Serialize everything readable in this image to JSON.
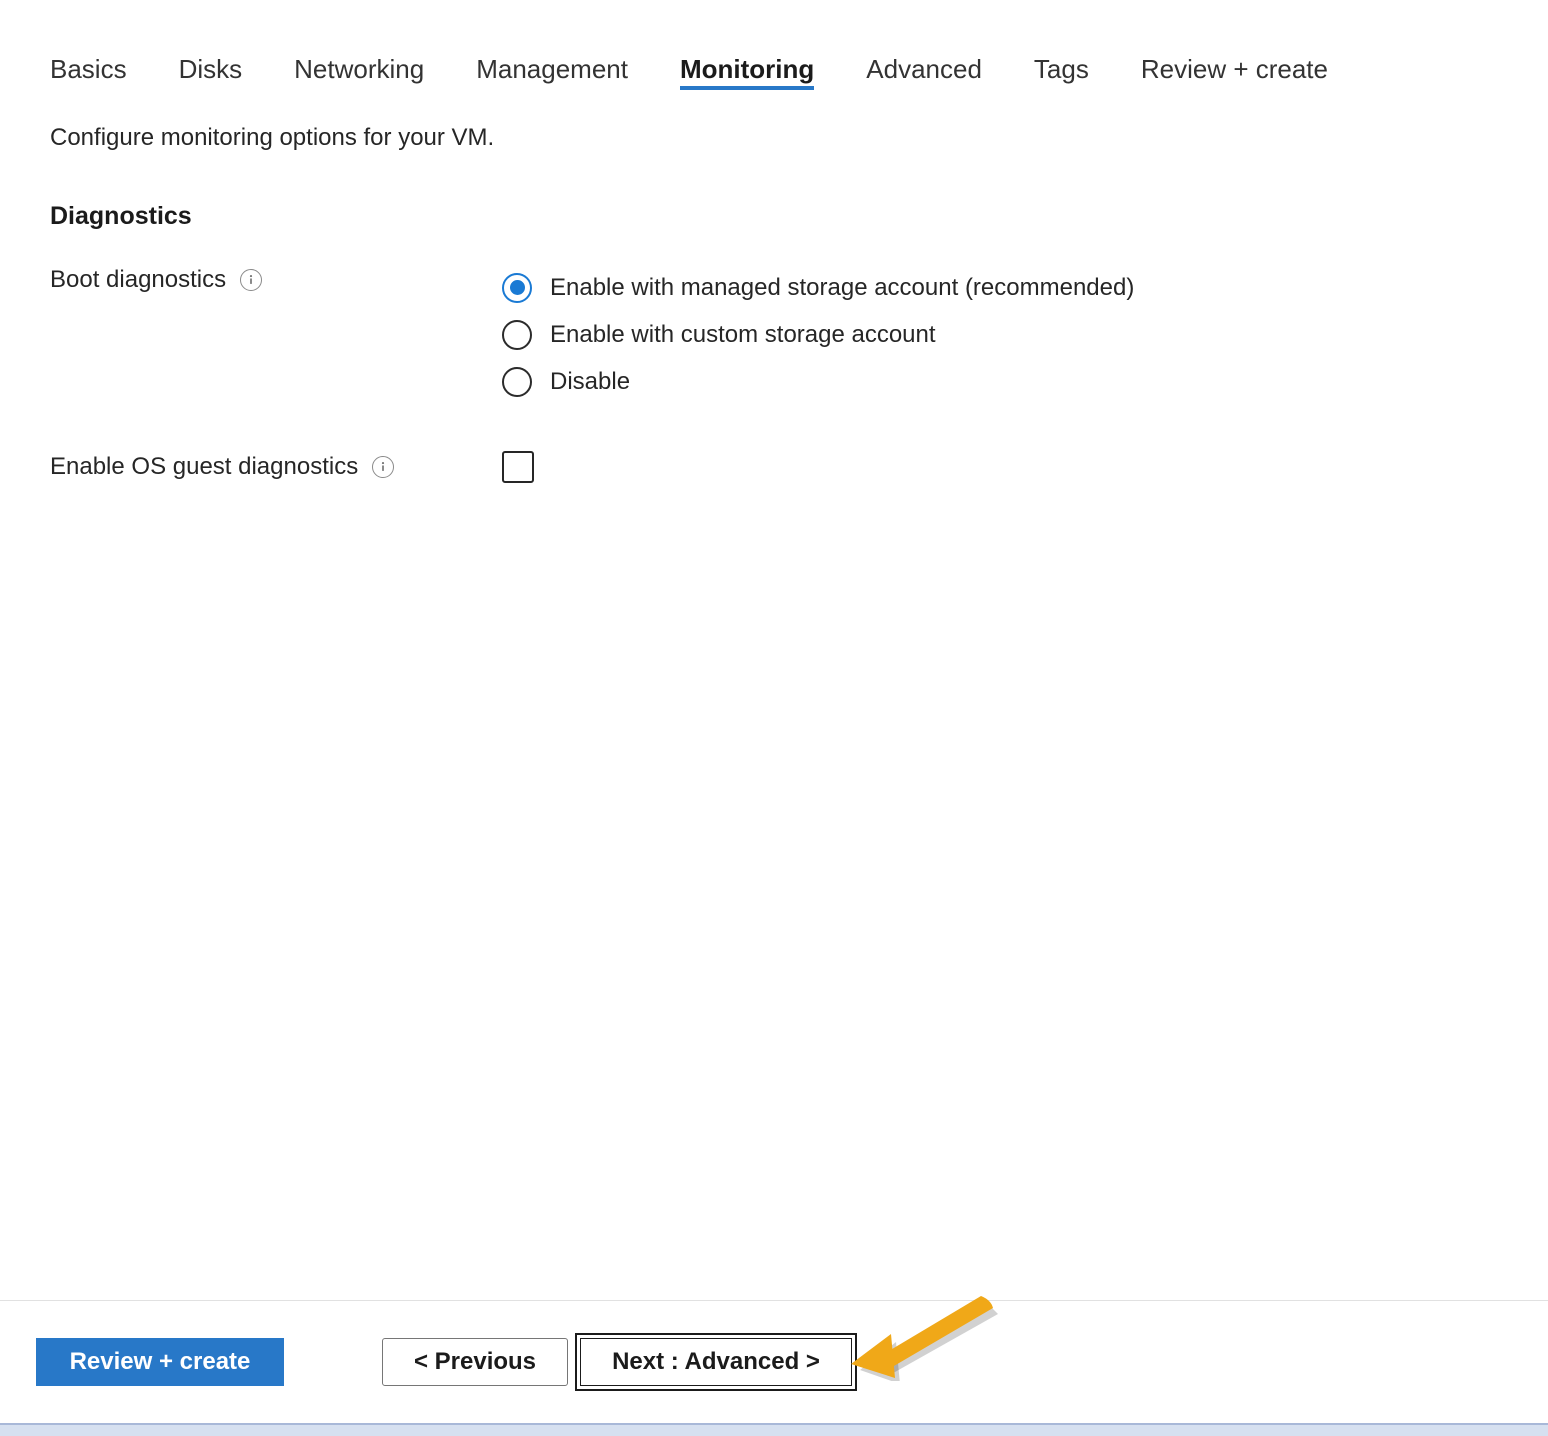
{
  "tabs": [
    {
      "label": "Basics",
      "active": false
    },
    {
      "label": "Disks",
      "active": false
    },
    {
      "label": "Networking",
      "active": false
    },
    {
      "label": "Management",
      "active": false
    },
    {
      "label": "Monitoring",
      "active": true
    },
    {
      "label": "Advanced",
      "active": false
    },
    {
      "label": "Tags",
      "active": false
    },
    {
      "label": "Review + create",
      "active": false
    }
  ],
  "intro": "Configure monitoring options for your VM.",
  "diagnostics": {
    "section_title": "Diagnostics",
    "boot_diagnostics": {
      "label": "Boot diagnostics",
      "info_icon": "info-icon",
      "options": [
        {
          "label": "Enable with managed storage account (recommended)",
          "selected": true
        },
        {
          "label": "Enable with custom storage account",
          "selected": false
        },
        {
          "label": "Disable",
          "selected": false
        }
      ]
    },
    "os_guest_diagnostics": {
      "label": "Enable OS guest diagnostics",
      "info_icon": "info-icon",
      "checked": false
    }
  },
  "footer": {
    "review_create_label": "Review + create",
    "previous_label": "< Previous",
    "next_label": "Next : Advanced >",
    "annotation_icon": "arrow-pointer-icon"
  },
  "colors": {
    "accent_blue": "#2878c8",
    "radio_selected_blue": "#1a7ad4",
    "annotation_orange": "#f0a818",
    "bottom_strip": "#d6e0f0"
  }
}
